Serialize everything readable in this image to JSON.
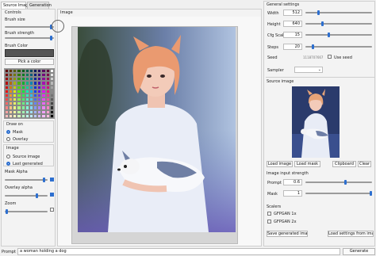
{
  "tabs": [
    {
      "label": "Source Image"
    },
    {
      "label": "Generation"
    }
  ],
  "controls": {
    "title": "Controls",
    "brush_size_label": "Brush size",
    "brush_size_value": 0.95,
    "brush_strength_label": "Brush strength",
    "brush_strength_value": 0.95,
    "brush_color_label": "Brush Color",
    "brush_color": "#555555",
    "pick_color_label": "Pick a color",
    "draw_on": {
      "title": "Draw on",
      "options": [
        {
          "label": "Mask",
          "selected": true
        },
        {
          "label": "Overlay",
          "selected": false
        }
      ]
    },
    "image": {
      "title": "Image",
      "options": [
        {
          "label": "Source image",
          "selected": false
        },
        {
          "label": "Last generated",
          "selected": true
        }
      ]
    },
    "mask_alpha": {
      "label": "Mask Alpha",
      "value": 0.92,
      "checked": true
    },
    "overlay_alpha": {
      "label": "Overlay alpha",
      "value": 0.72,
      "checked": true
    },
    "zoom": {
      "label": "Zoom",
      "value": 0.02,
      "checked": false
    }
  },
  "image_panel": {
    "title": "Image"
  },
  "general": {
    "title": "General settings",
    "width_label": "Width",
    "width_value": "512",
    "width_slider": 0.2,
    "height_label": "Height",
    "height_value": "640",
    "height_slider": 0.25,
    "cfg_label": "Cfg Scale",
    "cfg_value": "15",
    "cfg_slider": 0.35,
    "steps_label": "Steps",
    "steps_value": "20",
    "steps_slider": 0.12,
    "seed_label": "Seed",
    "seed_value": "1118707667",
    "use_seed_label": "Use seed",
    "use_seed": false,
    "sampler_label": "Sampler",
    "sampler_value": ""
  },
  "source_image": {
    "title": "Source image",
    "load_image": "Load image",
    "load_mask": "Load mask",
    "clipboard": "Clipboard",
    "clear": "Clear"
  },
  "strength": {
    "title": "Image input strength",
    "prompt_label": "Prompt",
    "prompt_value": "0.6",
    "prompt_slider": 0.6,
    "mask_label": "Mask",
    "mask_value": "1",
    "mask_slider": 1.0
  },
  "scalers": {
    "title": "Scalers",
    "items": [
      {
        "label": "GFPGAN 1x",
        "checked": false
      },
      {
        "label": "GFPGAN 2x",
        "checked": false
      }
    ]
  },
  "save_generated": "Save generated image",
  "load_settings": "Load settings from image",
  "bottom": {
    "prompt_label": "Prompt",
    "prompt_value": "a woman holding a dog",
    "generate": "Generate"
  },
  "colors": {
    "accent": "#2d6fcf",
    "panel": "#f3f3f3",
    "canvas_bg": "#dcdcdc"
  }
}
